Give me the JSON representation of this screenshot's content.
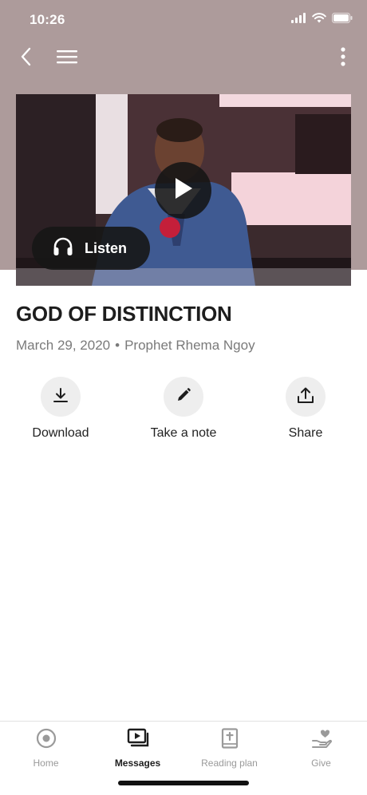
{
  "status_bar": {
    "time": "10:26",
    "icons": [
      "signal-icon",
      "wifi-icon",
      "battery-icon"
    ]
  },
  "colors": {
    "header_background": "#ad9b9b",
    "accent_dark": "#1d1d1d",
    "muted_text": "#7a7a7a",
    "inactive_tab": "#9a9a9a"
  },
  "navigation": {
    "icons": [
      "back-chevron-icon",
      "hamburger-menu-icon",
      "more-vertical-icon"
    ]
  },
  "video": {
    "thumbnail": "man-preaching-at-podium",
    "play_icon": "play-icon",
    "listen_label": "Listen",
    "listen_icon": "headphones-icon"
  },
  "message": {
    "title": "GOD OF DISTINCTION",
    "date": "March 29, 2020",
    "separator": "•",
    "speaker": "Prophet Rhema Ngoy"
  },
  "actions": [
    {
      "label": "Download",
      "icon": "download-icon"
    },
    {
      "label": "Take a note",
      "icon": "pencil-icon"
    },
    {
      "label": "Share",
      "icon": "share-icon"
    }
  ],
  "tabs": [
    {
      "label": "Home",
      "icon": "home-target-icon",
      "active": false
    },
    {
      "label": "Messages",
      "icon": "video-library-icon",
      "active": true
    },
    {
      "label": "Reading plan",
      "icon": "bible-icon",
      "active": false
    },
    {
      "label": "Give",
      "icon": "give-heart-hand-icon",
      "active": false
    }
  ]
}
